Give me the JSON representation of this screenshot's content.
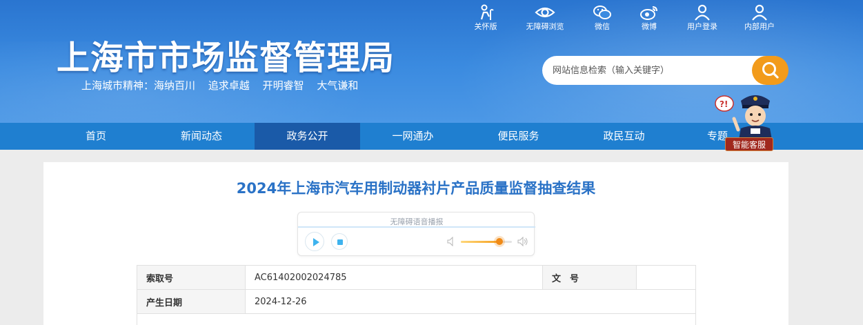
{
  "header": {
    "site_title": "上海市市场监督管理局",
    "slogan": [
      "上海城市精神：海纳百川",
      "追求卓越",
      "开明睿智",
      "大气谦和"
    ]
  },
  "top_links": [
    {
      "label": "关怀版",
      "icon": "elderly-care-icon"
    },
    {
      "label": "无障碍浏览",
      "icon": "eye-icon"
    },
    {
      "label": "微信",
      "icon": "wechat-icon"
    },
    {
      "label": "微博",
      "icon": "weibo-icon"
    },
    {
      "label": "用户登录",
      "icon": "user-icon"
    },
    {
      "label": "内部用户",
      "icon": "user-icon"
    }
  ],
  "search": {
    "placeholder": "网站信息检索（输入关键字）",
    "icon": "search-icon"
  },
  "nav": {
    "items": [
      "首页",
      "新闻动态",
      "政务公开",
      "一网通办",
      "便民服务",
      "政民互动",
      "专题"
    ],
    "active_index": 2
  },
  "assistant": {
    "label": "智能客服",
    "icon": "police-mascot-icon"
  },
  "article": {
    "title": "2024年上海市汽车用制动器衬片产品质量监督抽查结果"
  },
  "player": {
    "label": "无障碍语音播报",
    "volume_fraction": 0.75,
    "icons": [
      "play-icon",
      "stop-icon",
      "volume-low-icon",
      "volume-high-icon"
    ]
  },
  "meta": {
    "index_label": "索取号",
    "index_value": "AC61402002024785",
    "doc_no_label": "文　号",
    "doc_no_value": "",
    "date_label": "产生日期",
    "date_value": "2024-12-26"
  },
  "colors": {
    "header_blue": "#2a75d0",
    "nav_blue": "#1f7fd0",
    "nav_active": "#1a5aa8",
    "title_blue": "#2a72c6",
    "search_orange": "#f29b1b"
  }
}
